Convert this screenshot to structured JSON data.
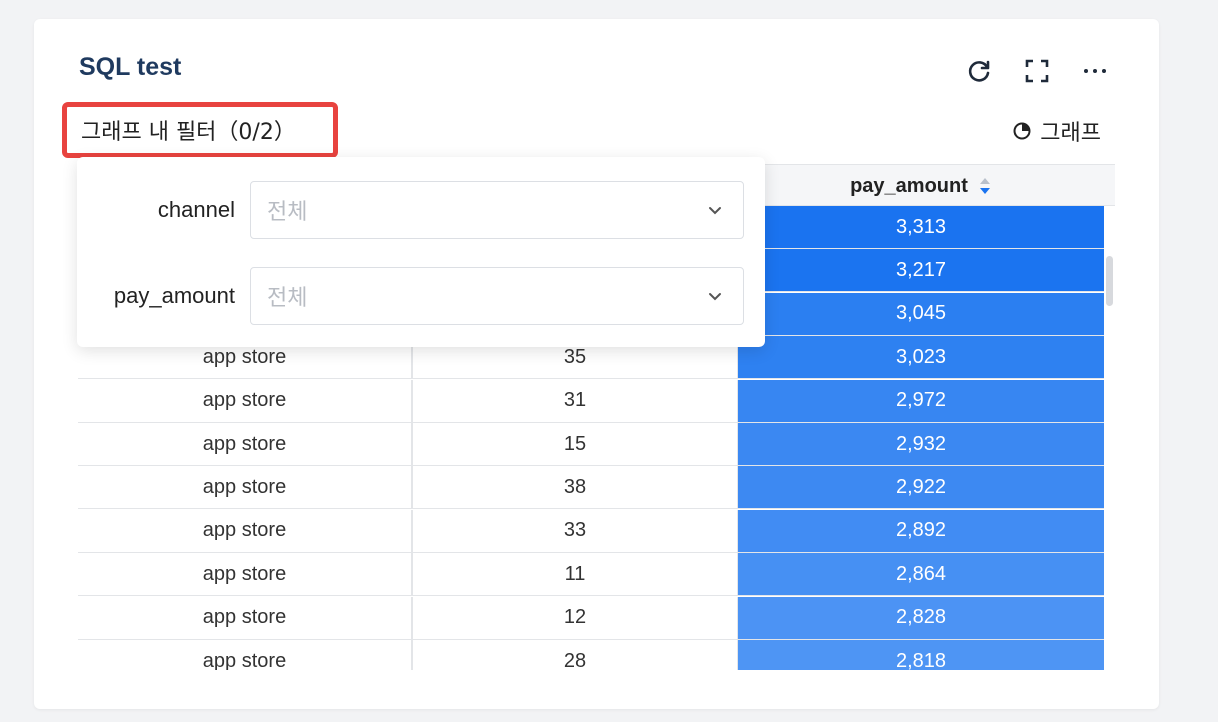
{
  "card": {
    "title": "SQL test"
  },
  "toolbar": {
    "icons": [
      "refresh-icon",
      "fullscreen-icon",
      "more-icon"
    ]
  },
  "filter": {
    "toggle_label": "그래프 내 필터（0/2）",
    "graph_label": "그래프",
    "fields": [
      {
        "label": "channel",
        "placeholder": "전체"
      },
      {
        "label": "pay_amount",
        "placeholder": "전체"
      }
    ]
  },
  "table": {
    "columns": [
      "",
      "",
      "pay_amount"
    ],
    "rows": [
      {
        "channel": "",
        "col2": "",
        "pay_amount": "3,313",
        "shade": "#1a73f0"
      },
      {
        "channel": "",
        "col2": "",
        "pay_amount": "3,217",
        "shade": "#1b74f0"
      },
      {
        "channel": "",
        "col2": "",
        "pay_amount": "3,045",
        "shade": "#2b7ff1"
      },
      {
        "channel": "app store",
        "col2": "35",
        "pay_amount": "3,023",
        "shade": "#2e81f1"
      },
      {
        "channel": "app store",
        "col2": "31",
        "pay_amount": "2,972",
        "shade": "#3786f2"
      },
      {
        "channel": "app store",
        "col2": "15",
        "pay_amount": "2,932",
        "shade": "#3b88f2"
      },
      {
        "channel": "app store",
        "col2": "38",
        "pay_amount": "2,922",
        "shade": "#3d89f2"
      },
      {
        "channel": "app store",
        "col2": "33",
        "pay_amount": "2,892",
        "shade": "#418cf3"
      },
      {
        "channel": "app store",
        "col2": "11",
        "pay_amount": "2,864",
        "shade": "#4690f3"
      },
      {
        "channel": "app store",
        "col2": "12",
        "pay_amount": "2,828",
        "shade": "#4c93f4"
      },
      {
        "channel": "app store",
        "col2": "28",
        "pay_amount": "2,818",
        "shade": "#4e95f4"
      }
    ]
  }
}
